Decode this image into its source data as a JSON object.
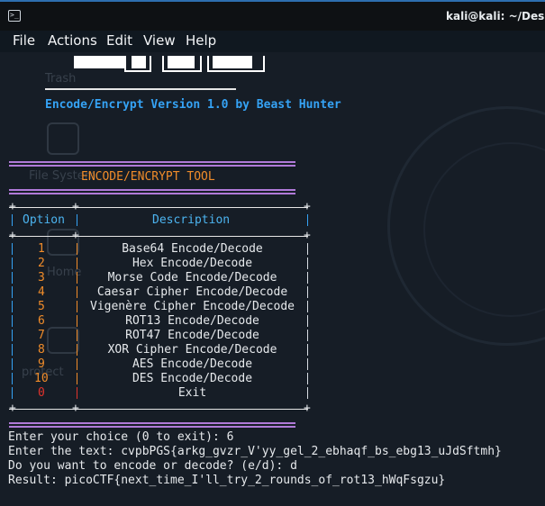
{
  "window": {
    "title": "kali@kali: ~/Desktop"
  },
  "menu": [
    "File",
    "Actions",
    "Edit",
    "View",
    "Help"
  ],
  "banner": "Encode/Encrypt Version 1.0 by Beast Hunter",
  "tool_title": "ENCODE/ENCRYPT TOOL",
  "table": {
    "headers": [
      "Option",
      "Description"
    ],
    "rows": [
      {
        "option": "1",
        "desc": "Base64 Encode/Decode"
      },
      {
        "option": "2",
        "desc": "Hex Encode/Decode"
      },
      {
        "option": "3",
        "desc": "Morse Code Encode/Decode"
      },
      {
        "option": "4",
        "desc": "Caesar Cipher Encode/Decode"
      },
      {
        "option": "5",
        "desc": "Vigenère Cipher Encode/Decode"
      },
      {
        "option": "6",
        "desc": "ROT13 Encode/Decode"
      },
      {
        "option": "7",
        "desc": "ROT47 Encode/Decode"
      },
      {
        "option": "8",
        "desc": "XOR Cipher Encode/Decode"
      },
      {
        "option": "9",
        "desc": "AES Encode/Decode"
      },
      {
        "option": "10",
        "desc": "DES Encode/Decode"
      },
      {
        "option": "0",
        "desc": "Exit"
      }
    ]
  },
  "session": [
    "Enter your choice (0 to exit): 6",
    "Enter the text: cvpbPGS{arkg_gvzr_V'yy_gel_2_ebhaqf_bs_ebg13_uJdSftmh}",
    "Do you want to encode or decode? (e/d): d",
    "Result: picoCTF{next_time_I'll_try_2_rounds_of_rot13_hWqFsgzu}"
  ],
  "desktop_ghosts": [
    "Trash",
    "File System",
    "Home",
    "protect"
  ]
}
